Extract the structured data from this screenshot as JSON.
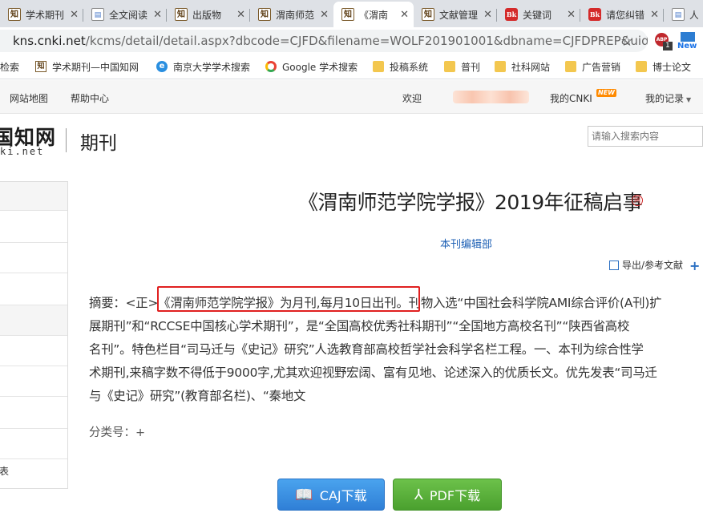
{
  "browser": {
    "tabs": [
      {
        "title": "学术期刊",
        "icon": "cnki-favicon",
        "active": false
      },
      {
        "title": "全文阅读",
        "icon": "document-favicon",
        "active": false
      },
      {
        "title": "出版物",
        "icon": "cnki-favicon",
        "active": false
      },
      {
        "title": "渭南师范",
        "icon": "cnki-favicon",
        "active": false
      },
      {
        "title": "《渭南",
        "icon": "cnki-favicon",
        "active": true
      },
      {
        "title": "文献管理",
        "icon": "cnki-favicon",
        "active": false
      },
      {
        "title": "关键词",
        "icon": "red-favicon",
        "active": false
      },
      {
        "title": "请您纠错",
        "icon": "red-favicon",
        "active": false
      },
      {
        "title": "人伍",
        "icon": "document-favicon",
        "active": false
      }
    ],
    "url_host": "kns.cnki.net",
    "url_path": "/kcms/detail/detail.aspx?dbcode=CJFD&filename=WOLF201901001&dbname=CJFDPREP&uid=...",
    "abp_label": "ABP",
    "abp_count": "1",
    "new_ext_label": "New",
    "bookmarks": [
      {
        "label": "检索",
        "icon": "cnki"
      },
      {
        "label": "学术期刊—中国知网",
        "icon": "cnki"
      },
      {
        "label": "南京大学学术搜索",
        "icon": "ie"
      },
      {
        "label": "Google 学术搜索",
        "icon": "google"
      },
      {
        "label": "投稿系统",
        "icon": "folder"
      },
      {
        "label": "普刊",
        "icon": "folder"
      },
      {
        "label": "社科网站",
        "icon": "folder"
      },
      {
        "label": "广告营销",
        "icon": "folder"
      },
      {
        "label": "博士论文",
        "icon": "folder"
      }
    ]
  },
  "site": {
    "nav": {
      "sitemap": "网站地图",
      "help": "帮助中心",
      "welcome": "欢迎",
      "my_cnki": "我的CNKI",
      "new_badge": "NEW",
      "my_records": "我的记录"
    },
    "logo_cn": "国知网",
    "logo_en": "ki.net",
    "section": "期刊",
    "search_placeholder": "请输入搜索内容",
    "sidebar_tail": "表"
  },
  "article": {
    "title": "《渭南师范学院学报》2019年征稿启事",
    "author": "本刊编辑部",
    "export": "导出/参考文献",
    "abstract_label": "摘要：",
    "abstract_lines": [
      "<正>《渭南师范学院学报》为月刊,每月10日出刊。刊物入选“中国社会科学院AMI综合评价(A刊)扩",
      "展期刊”和“RCCSE中国核心学术期刊”，是“全国高校优秀社科期刊”“全国地方高校名刊”“陕西省高校",
      "名刊”。特色栏目“司马迁与《史记》研究”人选教育部高校哲学社会科学名栏工程。一、本刊为综合性学",
      "术期刊,来稿字数不得低于9000字,尤其欢迎视野宏阔、富有见地、论述深入的优质长文。优先发表“司马迁",
      "与《史记》研究”(教育部名栏)、“秦地文"
    ],
    "classify_label": "分类号：",
    "classify_value": "+",
    "caj_button": "CAJ下载",
    "pdf_button": "PDF下载"
  }
}
